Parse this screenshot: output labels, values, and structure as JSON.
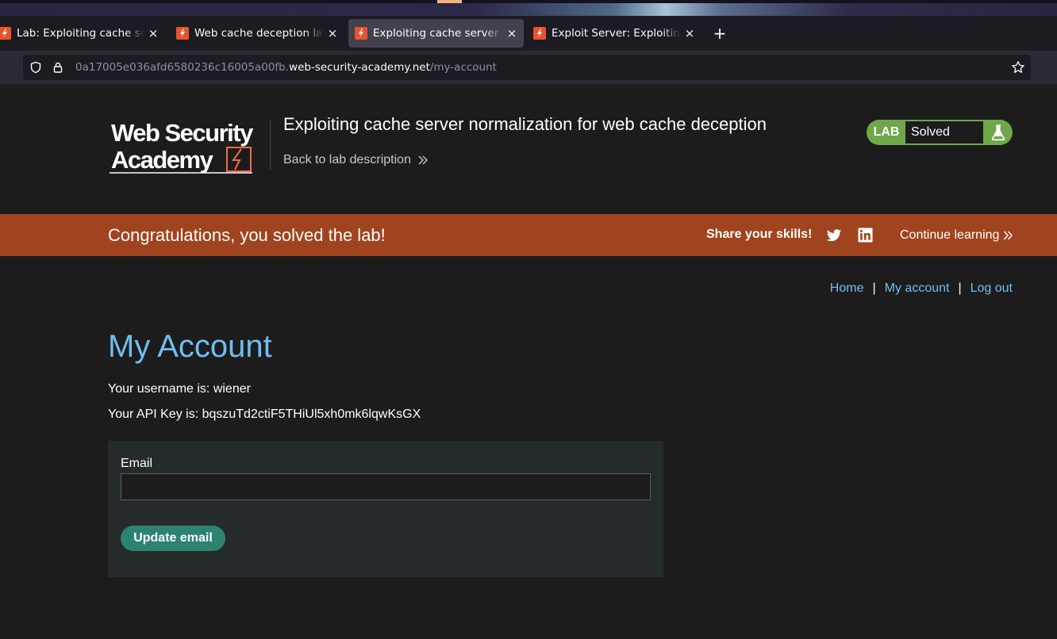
{
  "browser": {
    "tabs": [
      {
        "title": "Lab: Exploiting cache server normalization",
        "active": false
      },
      {
        "title": "Web cache deception lab",
        "active": false
      },
      {
        "title": "Exploiting cache server normalization",
        "active": true
      },
      {
        "title": "Exploit Server: Exploiting cache server",
        "active": false
      }
    ],
    "close_glyph": "×",
    "new_tab_glyph": "+",
    "url_prefix": "0a17005e036afd6580236c16005a00fb.",
    "url_host": "web-security-academy.net",
    "url_path": "/my-account"
  },
  "header": {
    "lab_title": "Exploiting cache server normalization for web cache deception",
    "back_link": "Back to lab description",
    "status_badge_label": "LAB",
    "status": "Solved",
    "logo_text_1": "Web Security",
    "logo_text_2": "Academy"
  },
  "banner": {
    "message": "Congratulations, you solved the lab!",
    "share_label": "Share your skills!",
    "continue_label": "Continue learning"
  },
  "nav": {
    "home": "Home",
    "separator": "|",
    "my_account": "My account",
    "log_out": "Log out"
  },
  "account": {
    "heading": "My Account",
    "username_line": "Your username is: wiener",
    "api_key_line": "Your API Key is: bqszuTd2ctiF5THiUl5xh0mk6lqwKsGX"
  },
  "form": {
    "email_label": "Email",
    "email_value": "",
    "submit_label": "Update email"
  },
  "colors": {
    "accent_blue": "#70bdf0",
    "banner_orange": "#a0441f",
    "solved_green": "#6ea84a",
    "button_teal": "#2d8370"
  }
}
